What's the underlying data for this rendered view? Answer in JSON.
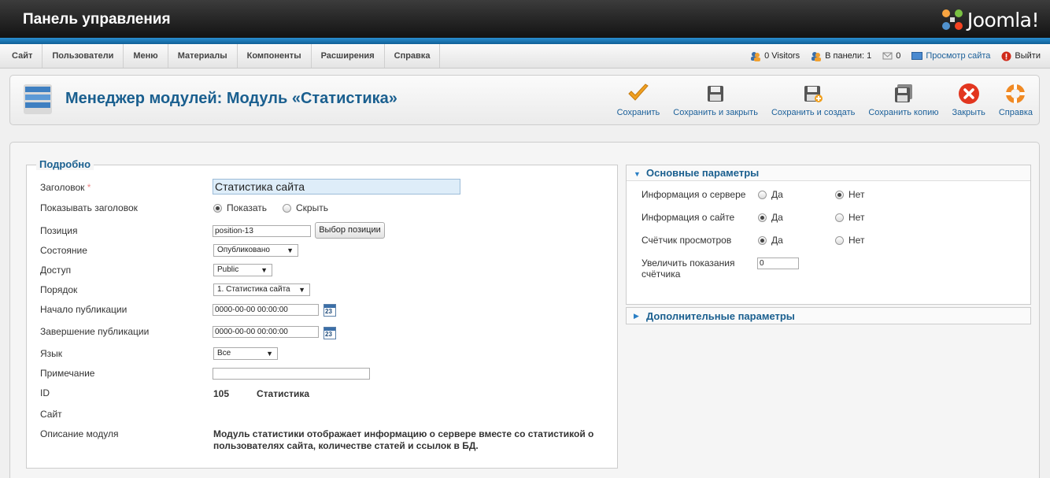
{
  "header": {
    "title": "Панель управления",
    "logo_text": "Joomla!"
  },
  "menu": [
    "Сайт",
    "Пользователи",
    "Меню",
    "Материалы",
    "Компоненты",
    "Расширения",
    "Справка"
  ],
  "status": {
    "visitors": "0 Visitors",
    "in_panel": "В панели: 1",
    "messages": "0",
    "view_site": "Просмотр сайта",
    "logout": "Выйти"
  },
  "page": {
    "title": "Менеджер модулей: Модуль «Статистика»"
  },
  "toolbar": {
    "save": "Сохранить",
    "save_close": "Сохранить и закрыть",
    "save_new": "Сохранить и создать",
    "save_copy": "Сохранить копию",
    "close": "Закрыть",
    "help": "Справка"
  },
  "details": {
    "legend": "Подробно",
    "title_label": "Заголовок",
    "required_mark": "*",
    "title_value": "Статистика сайта",
    "show_title_label": "Показывать заголовок",
    "show_option": "Показать",
    "hide_option": "Скрыть",
    "position_label": "Позиция",
    "position_value": "position-13",
    "position_button": "Выбор позиции",
    "state_label": "Состояние",
    "state_value": "Опубликовано",
    "access_label": "Доступ",
    "access_value": "Public",
    "order_label": "Порядок",
    "order_value": "1. Статистика сайта",
    "publish_up_label": "Начало публикации",
    "publish_up_value": "0000-00-00 00:00:00",
    "publish_down_label": "Завершение публикации",
    "publish_down_value": "0000-00-00 00:00:00",
    "calendar_text": "23",
    "language_label": "Язык",
    "language_value": "Все",
    "note_label": "Примечание",
    "note_value": "",
    "id_label": "ID",
    "id_value": "105",
    "id_module": "Статистика",
    "site_label": "Сайт",
    "desc_label": "Описание модуля",
    "desc_line1": "Модуль статистики отображает информацию о сервере вместе со статистикой о",
    "desc_line2": "пользователях сайта, количестве статей и ссылок в БД."
  },
  "params": {
    "basic_title": "Основные параметры",
    "server_info_label": "Информация о сервере",
    "site_info_label": "Информация о сайте",
    "hits_label": "Счётчик просмотров",
    "yes": "Да",
    "no": "Нет",
    "increase_label_1": "Увеличить показания",
    "increase_label_2": "счётчика",
    "increase_value": "0",
    "advanced_title": "Дополнительные параметры"
  }
}
